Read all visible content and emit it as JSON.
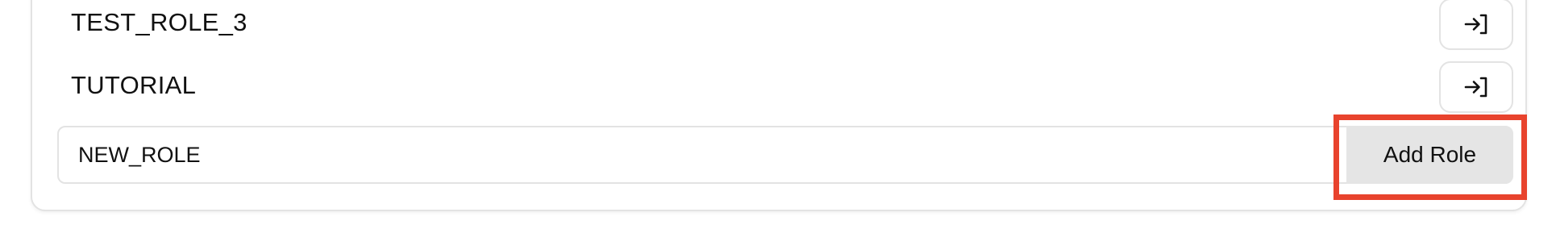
{
  "roles": [
    {
      "name": "TEST_ROLE_3",
      "action_icon": "enter-arrow-icon"
    },
    {
      "name": "TUTORIAL",
      "action_icon": "enter-arrow-icon"
    }
  ],
  "new_role_form": {
    "input_value": "NEW_ROLE",
    "add_button_label": "Add Role"
  },
  "colors": {
    "highlight": "#e8432d",
    "button_bg": "#e5e5e5",
    "border": "#e3e3e3"
  }
}
